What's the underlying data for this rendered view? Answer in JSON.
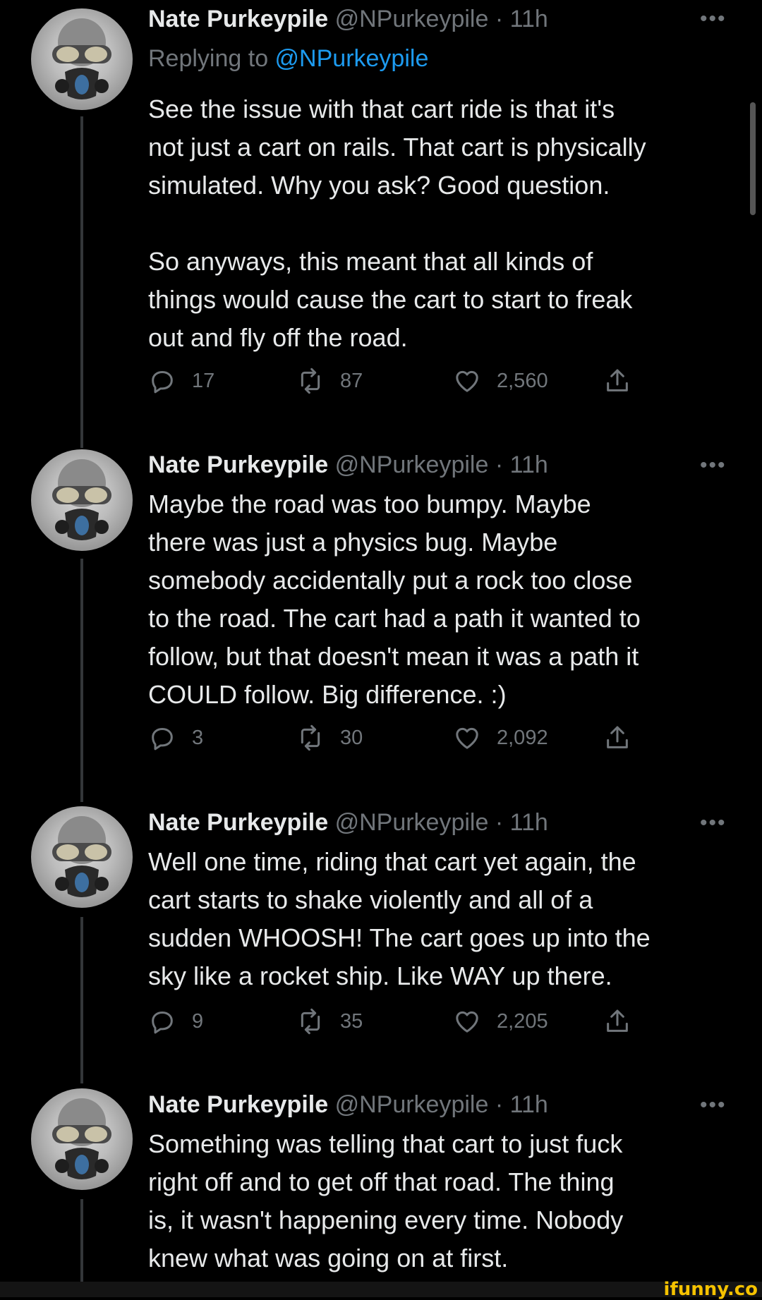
{
  "tweets": [
    {
      "name": "Nate Purkeypile",
      "handle": "@NPurkeypile",
      "dot": "·",
      "time": "11h",
      "more": "•••",
      "reply_prefix": "Replying to ",
      "reply_handle": "@NPurkeypile",
      "text": "See the issue with that cart ride is that it's\nnot just a cart on rails. That cart is physically\nsimulated. Why you ask? Good question.\n\nSo anyways, this meant that all kinds of\nthings would cause the cart to start to freak\nout and fly off the road.",
      "replies": "17",
      "retweets": "87",
      "likes": "2,560"
    },
    {
      "name": "Nate Purkeypile",
      "handle": "@NPurkeypile",
      "dot": "·",
      "time": "11h",
      "more": "•••",
      "text": "Maybe the road was too bumpy. Maybe\nthere was just a physics bug. Maybe\nsomebody accidentally put a rock too close\nto the road. The cart had a path it wanted to\nfollow, but that doesn't mean it was a path it\nCOULD follow. Big difference. :)",
      "replies": "3",
      "retweets": "30",
      "likes": "2,092"
    },
    {
      "name": "Nate Purkeypile",
      "handle": "@NPurkeypile",
      "dot": "·",
      "time": "11h",
      "more": "•••",
      "text": "Well one time, riding that cart yet again, the\ncart starts to shake violently and all of a\nsudden WHOOSH! The cart goes up into the\nsky like a rocket ship. Like WAY up there.",
      "replies": "9",
      "retweets": "35",
      "likes": "2,205"
    },
    {
      "name": "Nate Purkeypile",
      "handle": "@NPurkeypile",
      "dot": "·",
      "time": "11h",
      "more": "•••",
      "text": "Something was telling that cart to just fuck\nright off and to get off that road. The thing\nis, it wasn't happening every time. Nobody\nknew what was going on at first."
    }
  ],
  "watermark": "ifunny.co",
  "colors": {
    "background": "#000000",
    "text": "#e7e9ea",
    "muted": "#71767b",
    "link": "#1d9bf0"
  },
  "icons": [
    "reply-icon",
    "retweet-icon",
    "like-icon",
    "share-icon",
    "more-icon",
    "avatar"
  ]
}
